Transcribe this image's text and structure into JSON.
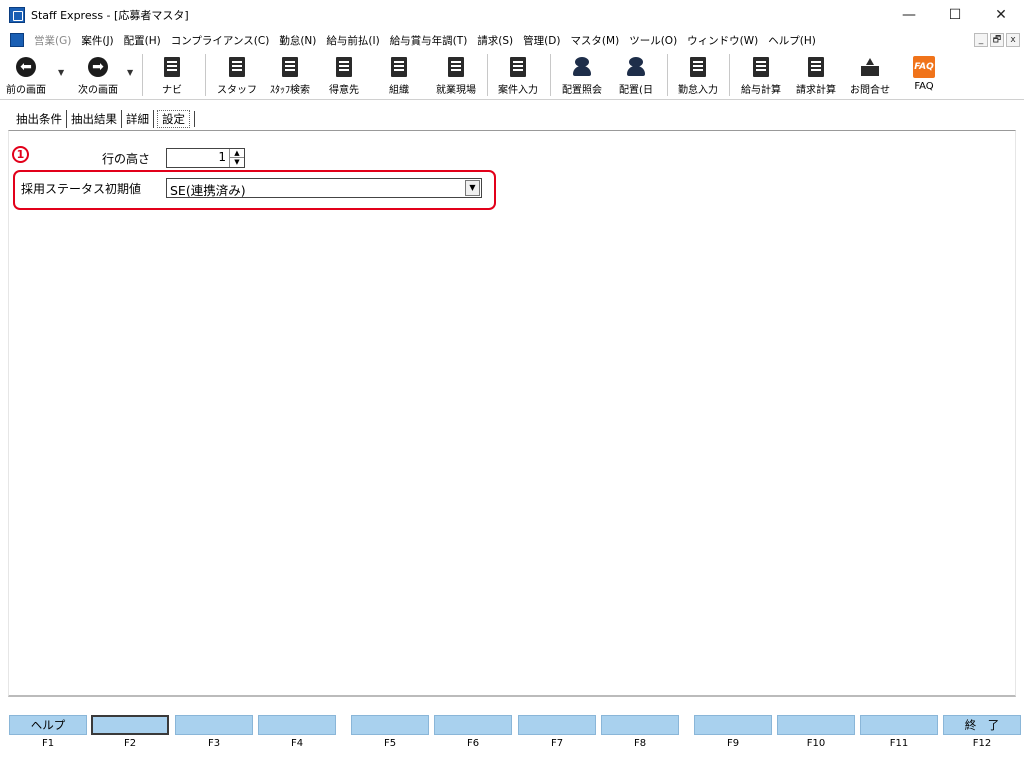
{
  "window": {
    "title": "Staff Express - [応募者マスタ]",
    "controls": [
      "—",
      "☐",
      "✕"
    ]
  },
  "menu": {
    "items": [
      {
        "label": "営業(G)",
        "disabled": true
      },
      {
        "label": "案件(J)"
      },
      {
        "label": "配置(H)"
      },
      {
        "label": "コンプライアンス(C)"
      },
      {
        "label": "勤怠(N)"
      },
      {
        "label": "給与前払(I)"
      },
      {
        "label": "給与賞与年調(T)"
      },
      {
        "label": "請求(S)"
      },
      {
        "label": "管理(D)"
      },
      {
        "label": "マスタ(M)"
      },
      {
        "label": "ツール(O)"
      },
      {
        "label": "ウィンドウ(W)"
      },
      {
        "label": "ヘルプ(H)"
      }
    ],
    "mdi_controls": [
      "_",
      "🗗",
      "x"
    ]
  },
  "toolbar": {
    "back": "前の画面",
    "forward": "次の画面",
    "navi": "ナビ",
    "staff": "スタッフ",
    "staff_search": "ｽﾀｯﾌ検索",
    "client": "得意先",
    "organization": "組織",
    "worksite": "就業現場",
    "case_input": "案件入力",
    "placement_inquiry": "配置照会",
    "placement_daily": "配置(日",
    "attendance_input": "勤怠入力",
    "salary_calc": "給与計算",
    "billing_calc": "請求計算",
    "contact": "お問合せ",
    "faq": "FAQ",
    "faq_icon_text": "FAQ"
  },
  "tabs": [
    {
      "label": "抽出条件",
      "active": false
    },
    {
      "label": "抽出結果",
      "active": false
    },
    {
      "label": "詳細",
      "active": false
    },
    {
      "label": "設定",
      "active": true
    }
  ],
  "settings": {
    "marker": "1",
    "row_height_label": "行の高さ",
    "row_height_value": "1",
    "status_label": "採用ステータス初期値",
    "status_value": "SE(連携済み)"
  },
  "fkeys": [
    {
      "key": "F1",
      "label": "ヘルプ"
    },
    {
      "key": "F2",
      "label": ""
    },
    {
      "key": "F3",
      "label": ""
    },
    {
      "key": "F4",
      "label": ""
    },
    {
      "key": "F5",
      "label": ""
    },
    {
      "key": "F6",
      "label": ""
    },
    {
      "key": "F7",
      "label": ""
    },
    {
      "key": "F8",
      "label": ""
    },
    {
      "key": "F9",
      "label": ""
    },
    {
      "key": "F10",
      "label": ""
    },
    {
      "key": "F11",
      "label": ""
    },
    {
      "key": "F12",
      "label": "終　了"
    }
  ],
  "colors": {
    "accent_red": "#e2001a",
    "fkey_blue": "#a9d1ee",
    "app_blue": "#1a5fb4"
  }
}
